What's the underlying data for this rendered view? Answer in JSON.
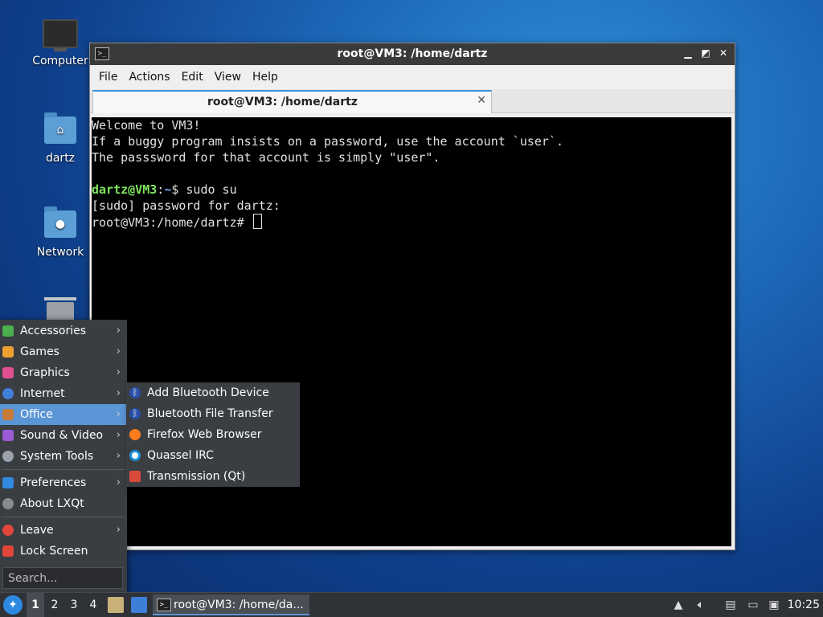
{
  "desktop": {
    "icons": [
      {
        "label": "Computer",
        "icon": "computer-icon"
      },
      {
        "label": "dartz",
        "icon": "home-folder-icon"
      },
      {
        "label": "Network",
        "icon": "network-folder-icon"
      },
      {
        "label": "",
        "icon": "trash-icon"
      }
    ]
  },
  "terminal_window": {
    "title": "root@VM3: /home/dartz",
    "menu": [
      "File",
      "Actions",
      "Edit",
      "View",
      "Help"
    ],
    "tab_label": "root@VM3: /home/dartz",
    "lines": {
      "l1": "Welcome to VM3!",
      "l2": "If a buggy program insists on a password, use the account `user`.",
      "l3": "The passsword for that account is simply \"user\".",
      "prompt_user": "dartz@VM3",
      "prompt_sep": ":",
      "prompt_path": "~",
      "prompt_cmd": "$ sudo su",
      "l5": "[sudo] password for dartz:",
      "l6": "root@VM3:/home/dartz# "
    }
  },
  "start_menu": {
    "items": [
      {
        "label": "Accessories",
        "color": "#4caf50"
      },
      {
        "label": "Games",
        "color": "#f0a030"
      },
      {
        "label": "Graphics",
        "color": "#e05090"
      },
      {
        "label": "Internet",
        "color": "#3f7fd8"
      },
      {
        "label": "Office",
        "color": "#c77b3a"
      },
      {
        "label": "Sound & Video",
        "color": "#9c5ad6"
      },
      {
        "label": "System Tools",
        "color": "#9aa3ad"
      }
    ],
    "items2": [
      {
        "label": "Preferences",
        "color": "#2f8ae0"
      },
      {
        "label": "About LXQt",
        "color": "#8a8a8a"
      }
    ],
    "items3": [
      {
        "label": "Leave",
        "color": "#e0473a"
      },
      {
        "label": "Lock Screen",
        "color": "#e0473a"
      }
    ],
    "search_placeholder": "Search..."
  },
  "submenu": {
    "items": [
      {
        "label": "Add Bluetooth Device",
        "icon": "bluetooth-icon"
      },
      {
        "label": "Bluetooth File Transfer",
        "icon": "bluetooth-icon"
      },
      {
        "label": "Firefox Web Browser",
        "icon": "firefox-icon"
      },
      {
        "label": "Quassel IRC",
        "icon": "quassel-icon"
      },
      {
        "label": "Transmission (Qt)",
        "icon": "transmission-icon"
      }
    ]
  },
  "taskbar": {
    "workspaces": [
      "1",
      "2",
      "3",
      "4"
    ],
    "task_label": "root@VM3: /home/da...",
    "clock": "10:25"
  }
}
